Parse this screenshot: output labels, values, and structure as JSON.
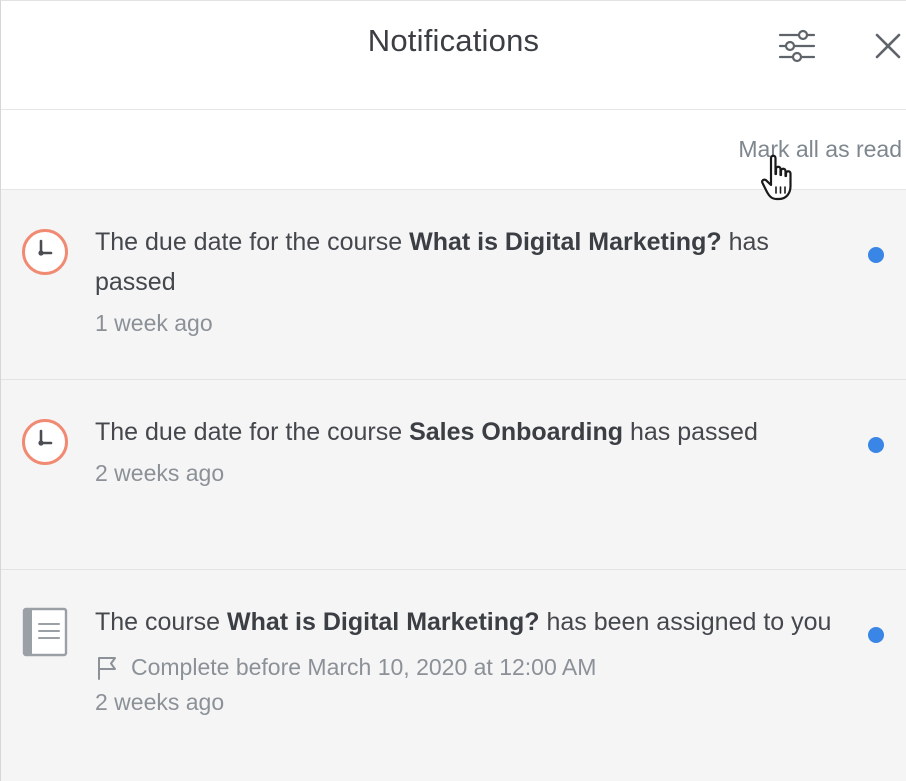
{
  "header": {
    "title": "Notifications",
    "filter_icon": "sliders-icon",
    "close_icon": "close-icon"
  },
  "toolbar": {
    "mark_all_label": "Mark all as read"
  },
  "notifications": [
    {
      "icon": "clock-icon",
      "prefix": "The due date for the course ",
      "course": "What is Digital Marketing?",
      "suffix": " has passed",
      "time": "1 week ago",
      "unread": true
    },
    {
      "icon": "clock-icon",
      "prefix": "The due date for the course ",
      "course": "Sales Onboarding",
      "suffix": " has passed",
      "time": "2 weeks ago",
      "unread": true
    },
    {
      "icon": "course-document-icon",
      "prefix": "The course ",
      "course": "What is Digital Marketing?",
      "suffix": " has been assigned to you",
      "deadline": "Complete before March 10, 2020 at 12:00 AM",
      "time": "2 weeks ago",
      "unread": true
    }
  ],
  "colors": {
    "unread_dot": "#3a86e6",
    "overdue_icon": "#f08a72",
    "muted_text": "#8b9197"
  }
}
